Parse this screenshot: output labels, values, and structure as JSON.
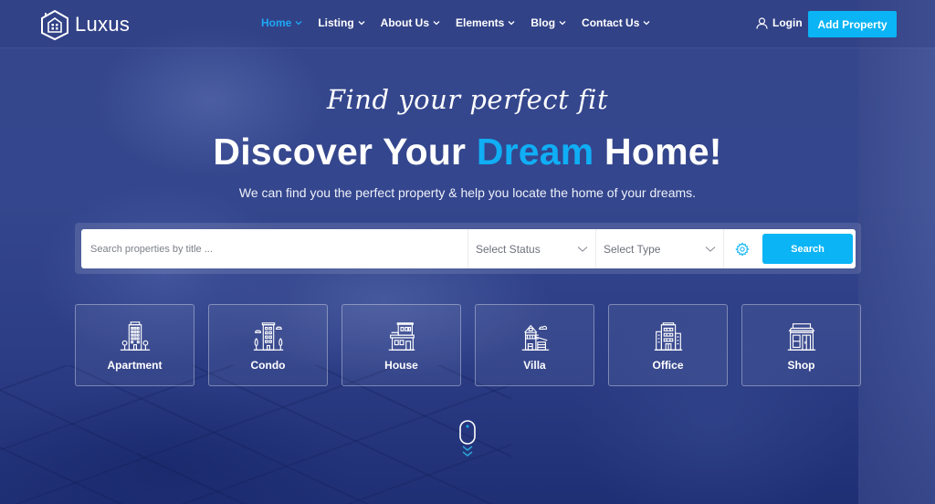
{
  "brand": {
    "name": "Luxus",
    "logo_icon": "house-logo-icon"
  },
  "nav": {
    "items": [
      {
        "label": "Home",
        "active": true
      },
      {
        "label": "Listing",
        "active": false
      },
      {
        "label": "About Us",
        "active": false
      },
      {
        "label": "Elements",
        "active": false
      },
      {
        "label": "Blog",
        "active": false
      },
      {
        "label": "Contact Us",
        "active": false
      }
    ],
    "login_label": "Login",
    "add_property_label": "Add Property"
  },
  "hero": {
    "tagline": "Find your perfect fit",
    "headline_before": "Discover Your ",
    "headline_accent": "Dream",
    "headline_after": " Home!",
    "subline": "We can find you the perfect property & help you locate the home of your dreams."
  },
  "search": {
    "placeholder": "Search properties by title ...",
    "value": "",
    "status_select": "Select Status",
    "type_select": "Select Type",
    "advanced_icon": "gear-icon",
    "button_label": "Search"
  },
  "categories": [
    {
      "label": "Apartment",
      "icon": "apartment-icon"
    },
    {
      "label": "Condo",
      "icon": "condo-icon"
    },
    {
      "label": "House",
      "icon": "house-icon"
    },
    {
      "label": "Villa",
      "icon": "villa-icon"
    },
    {
      "label": "Office",
      "icon": "office-icon"
    },
    {
      "label": "Shop",
      "icon": "shop-icon"
    }
  ],
  "colors": {
    "accent": "#0ab4f5",
    "nav_active": "#1da8f5",
    "overlay": "#34468d"
  }
}
